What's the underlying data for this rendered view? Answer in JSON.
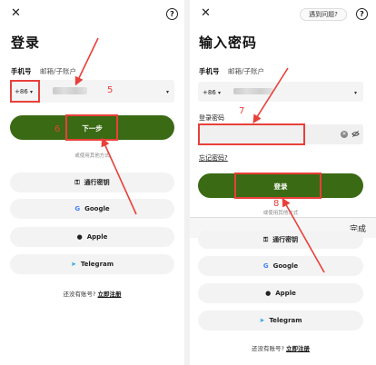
{
  "left": {
    "title": "登录",
    "tabs": [
      "手机号",
      "邮箱/子账户"
    ],
    "phone": {
      "code": "+86",
      "caret": "▾"
    },
    "annotation_field": "5",
    "annotation_button": "6",
    "next_button": "下一步",
    "or_text": "或使用其他方式",
    "alt_buttons": [
      {
        "icon": "passkey-icon",
        "glyph": "⚿",
        "label": "通行密钥"
      },
      {
        "icon": "google-icon",
        "glyph": "G",
        "label": "Google"
      },
      {
        "icon": "apple-icon",
        "glyph": "●",
        "label": "Apple"
      },
      {
        "icon": "telegram-icon",
        "glyph": "➤",
        "label": "Telegram"
      }
    ],
    "no_account": "还没有账号?",
    "register": "立即注册"
  },
  "right": {
    "problem": "遇到问题?",
    "title": "输入密码",
    "tabs": [
      "手机号",
      "邮箱/子账户"
    ],
    "phone": {
      "code": "+86",
      "caret": "▾"
    },
    "password_label": "登录密码",
    "annotation_password": "7",
    "forgot": "忘记密码?",
    "login_button": "登录",
    "or_text": "或使用其他方式",
    "annotation_button": "8",
    "done": "完成",
    "alt_buttons": [
      {
        "icon": "passkey-icon",
        "glyph": "⚿",
        "label": "通行密钥"
      },
      {
        "icon": "google-icon",
        "glyph": "G",
        "label": "Google"
      },
      {
        "icon": "apple-icon",
        "glyph": "●",
        "label": "Apple"
      },
      {
        "icon": "telegram-icon",
        "glyph": "➤",
        "label": "Telegram"
      }
    ],
    "no_account": "还没有账号?",
    "register": "立即注册"
  },
  "colors": {
    "brand_green": "#3a6a14",
    "annotation_red": "#e8403a"
  }
}
